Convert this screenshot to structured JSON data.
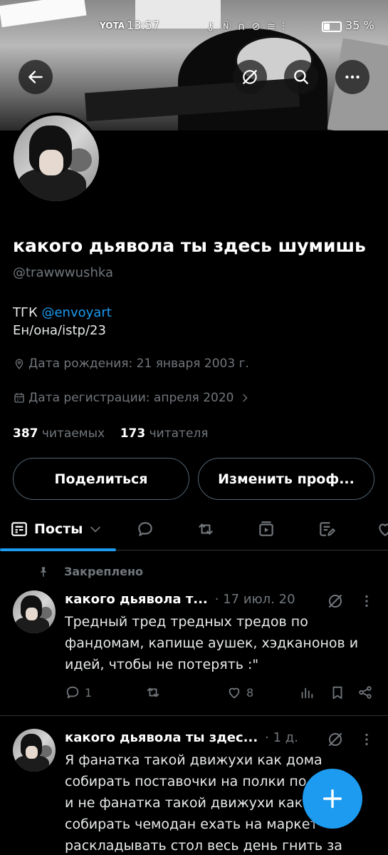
{
  "status_bar": {
    "carrier": "YOTA",
    "time": "13:57",
    "icons": "⚷ Ⓝ ∩ ⊘ ≋ ⫶",
    "battery_percent": "35 %",
    "battery_level": 0.35
  },
  "profile": {
    "display_name": "какого дьявола ты здесь шумишь",
    "handle": "@trawwwushka",
    "bio_prefix": "ТГК ",
    "bio_link": "@envoyart",
    "bio_line2": "Ен/она/istp/23",
    "birthday": "Дата рождения: 21 января 2003 г.",
    "joined": "Дата регистрации: апреля 2020",
    "following_count": "387",
    "following_label": "читаемых",
    "followers_count": "173",
    "followers_label": "читателя"
  },
  "buttons": {
    "share": "Поделиться",
    "edit_profile": "Изменить проф..."
  },
  "tabs": {
    "posts_label": "Посты"
  },
  "posts": [
    {
      "pinned_label": "Закреплено",
      "author": "какого дьявола т...",
      "time": "· 17 июл. 20",
      "text": "Тредный тред тредных тредов по фандомам, капище аушек, хэдканонов и идей, чтобы не потерять :\"",
      "replies": "1",
      "likes": "8"
    },
    {
      "author": "какого дьявола ты здес...",
      "time": "· 1 д.",
      "text": "Я фанатка такой движухи как дома собирать поставочки на полки по аниме и не фанатка такой движухи как собирать чемодан ехать на маркет раскладывать стол весь день гнить за"
    }
  ],
  "colors": {
    "accent": "#1d9bf0",
    "muted": "#71767b",
    "border": "#2f3336",
    "background": "#000000"
  }
}
